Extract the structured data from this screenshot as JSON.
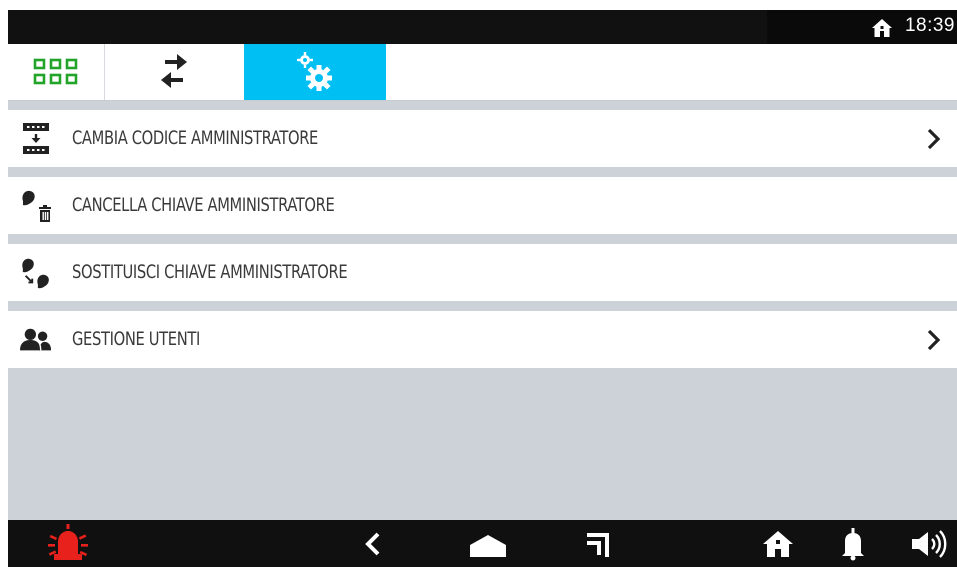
{
  "status_bar": {
    "time": "18:39",
    "home_icon": "home-icon"
  },
  "tabs": [
    {
      "id": "apps",
      "icon": "apps-grid-icon",
      "active": false,
      "color": "#22a32a"
    },
    {
      "id": "transfer",
      "icon": "swap-arrows-icon",
      "active": false
    },
    {
      "id": "settings",
      "icon": "gears-icon",
      "active": true,
      "color": "#00bff3"
    }
  ],
  "menu": {
    "items": [
      {
        "label": "CAMBIA CODICE AMMINISTRATORE",
        "icon": "keypad-code-icon",
        "has_chevron": true
      },
      {
        "label": "CANCELLA CHIAVE AMMINISTRATORE",
        "icon": "key-delete-icon",
        "has_chevron": false
      },
      {
        "label": "SOSTITUISCI CHIAVE AMMINISTRATORE",
        "icon": "key-replace-icon",
        "has_chevron": false
      },
      {
        "label": "GESTIONE UTENTI",
        "icon": "users-icon",
        "has_chevron": true
      }
    ]
  },
  "nav_bar": {
    "buttons": [
      "alarm-icon",
      "back-icon",
      "home-icon",
      "recent-apps-icon",
      "home-icon",
      "bell-icon",
      "speaker-icon"
    ],
    "alarm_color": "#e8211c"
  },
  "colors": {
    "accent": "#00bff3",
    "apps_green": "#22a32a",
    "background": "#cdd2d9",
    "bars": "#111111"
  }
}
